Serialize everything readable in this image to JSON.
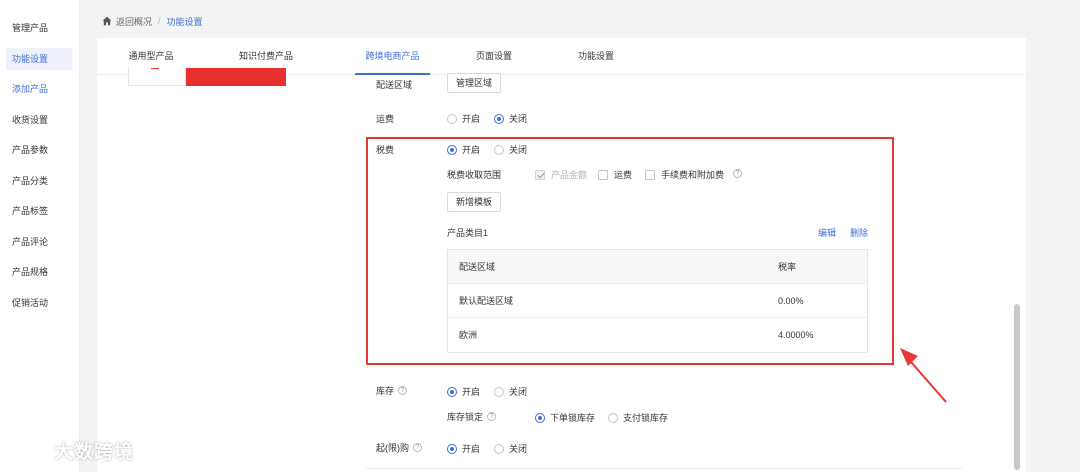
{
  "sidebar": {
    "items": [
      {
        "label": "管理产品"
      },
      {
        "label": "功能设置"
      },
      {
        "label": "添加产品"
      },
      {
        "label": "收货设置"
      },
      {
        "label": "产品参数"
      },
      {
        "label": "产品分类"
      },
      {
        "label": "产品标签"
      },
      {
        "label": "产品评论"
      },
      {
        "label": "产品规格"
      },
      {
        "label": "促销活动"
      }
    ],
    "active_index": 1
  },
  "breadcrumb": {
    "back_label": "返回概况",
    "separator": "/",
    "current_label": "功能设置"
  },
  "tabs": [
    {
      "label": "通用型产品"
    },
    {
      "label": "知识付费产品"
    },
    {
      "label": "跨境电商产品"
    },
    {
      "label": "页面设置"
    },
    {
      "label": "功能设置"
    }
  ],
  "active_tab_index": 2,
  "form": {
    "delivery_area": {
      "label": "配送区域",
      "button": "管理区域"
    },
    "shipping": {
      "label": "运费",
      "options": [
        "开启",
        "关闭"
      ],
      "selected": "关闭"
    },
    "tax": {
      "label": "税费",
      "options": [
        "开启",
        "关闭"
      ],
      "selected": "开启",
      "scope_label": "税费收取范围",
      "scope_items": [
        {
          "label": "产品金额",
          "checked": true,
          "disabled": true
        },
        {
          "label": "运费",
          "checked": false,
          "disabled": false
        },
        {
          "label": "手续费和附加费",
          "checked": false,
          "disabled": false
        }
      ],
      "help_glyph": "?",
      "add_template_button": "新增模板",
      "category_title": "产品类目1",
      "edit_link": "编辑",
      "delete_link": "删除",
      "table": {
        "headers": [
          "配送区域",
          "税率"
        ],
        "rows": [
          [
            "默认配送区域",
            "0.00%"
          ],
          [
            "欧洲",
            "4.0000%"
          ]
        ]
      }
    },
    "inventory": {
      "label": "库存",
      "options": [
        "开启",
        "关闭"
      ],
      "selected": "开启",
      "lock_label": "库存锁定",
      "lock_options": [
        "下单锁库存",
        "支付锁库存"
      ],
      "lock_selected": "下单锁库存"
    },
    "min_purchase": {
      "label": "起(限)购",
      "options": [
        "开启",
        "关闭"
      ],
      "selected": "开启"
    }
  },
  "watermark": {
    "text": "大数跨境"
  },
  "colors": {
    "accent": "#3e6fd6",
    "highlight_red": "#e53935",
    "banner_red": "#e8312f"
  },
  "icons": {
    "home": "home-icon",
    "help": "help-icon",
    "annotation_arrow": "arrow-icon"
  }
}
